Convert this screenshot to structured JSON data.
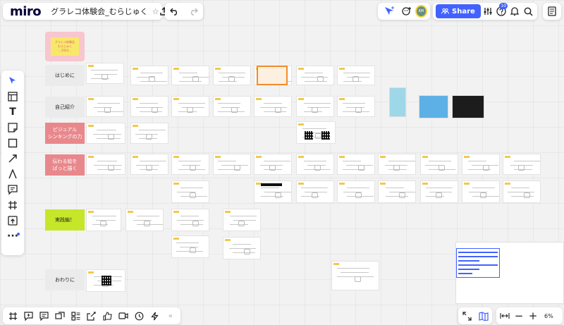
{
  "app": {
    "logo": "miro",
    "board_title": "グラレコ体験会_むらじゅく",
    "share_label": "Share",
    "notification_count": "10",
    "avatar_initials": "KM",
    "zoom": "6%",
    "accent_color": "#4262ff"
  },
  "top_left_icons": [
    "star-icon",
    "upload-icon",
    "undo-icon",
    "redo-icon"
  ],
  "top_right_icons": [
    "cursor-icon",
    "add-reaction-icon",
    "settings-sliders-icon",
    "help-icon",
    "bell-icon",
    "search-icon",
    "notes-icon"
  ],
  "left_toolbar": [
    "select-icon",
    "frame-icon",
    "text-icon",
    "sticky-note-icon",
    "shape-icon",
    "line-icon",
    "pen-icon",
    "comment-icon",
    "crop-frame-icon",
    "upload-icon",
    "more-icon"
  ],
  "bottom_toolbar": [
    "frames-icon",
    "comments-icon",
    "chat-icon",
    "screen-share-icon",
    "layouts-icon",
    "share-out-icon",
    "like-icon",
    "video-icon",
    "timer-icon",
    "lightning-icon",
    "collapse-icon"
  ],
  "bottom_right_icons": [
    "fit-screen-icon",
    "map-icon",
    "fit-width-icon",
    "zoom-out-icon",
    "zoom-in-icon"
  ],
  "sections": [
    {
      "label": "はじめに",
      "color": "#ebebeb",
      "text_color": "#222222"
    },
    {
      "label": "自己紹介",
      "color": "#ebebeb",
      "text_color": "#222222"
    },
    {
      "label": "ビジュアル\nシンキングの力",
      "color": "#e8888c",
      "text_color": "#ffffff"
    },
    {
      "label": "伝わる絵を\nぱっと描く",
      "color": "#e8888c",
      "text_color": "#ffffff"
    },
    {
      "label": "実践編！",
      "color": "#c6e62a",
      "text_color": "#222222"
    },
    {
      "label": "おわりに",
      "color": "#ebebeb",
      "text_color": "#222222"
    }
  ],
  "title_card": {
    "text": "グラレコ体験会\nむらじゅく\n…2024…",
    "color": "#f7c6cf",
    "inner_color": "#f8e86a"
  }
}
